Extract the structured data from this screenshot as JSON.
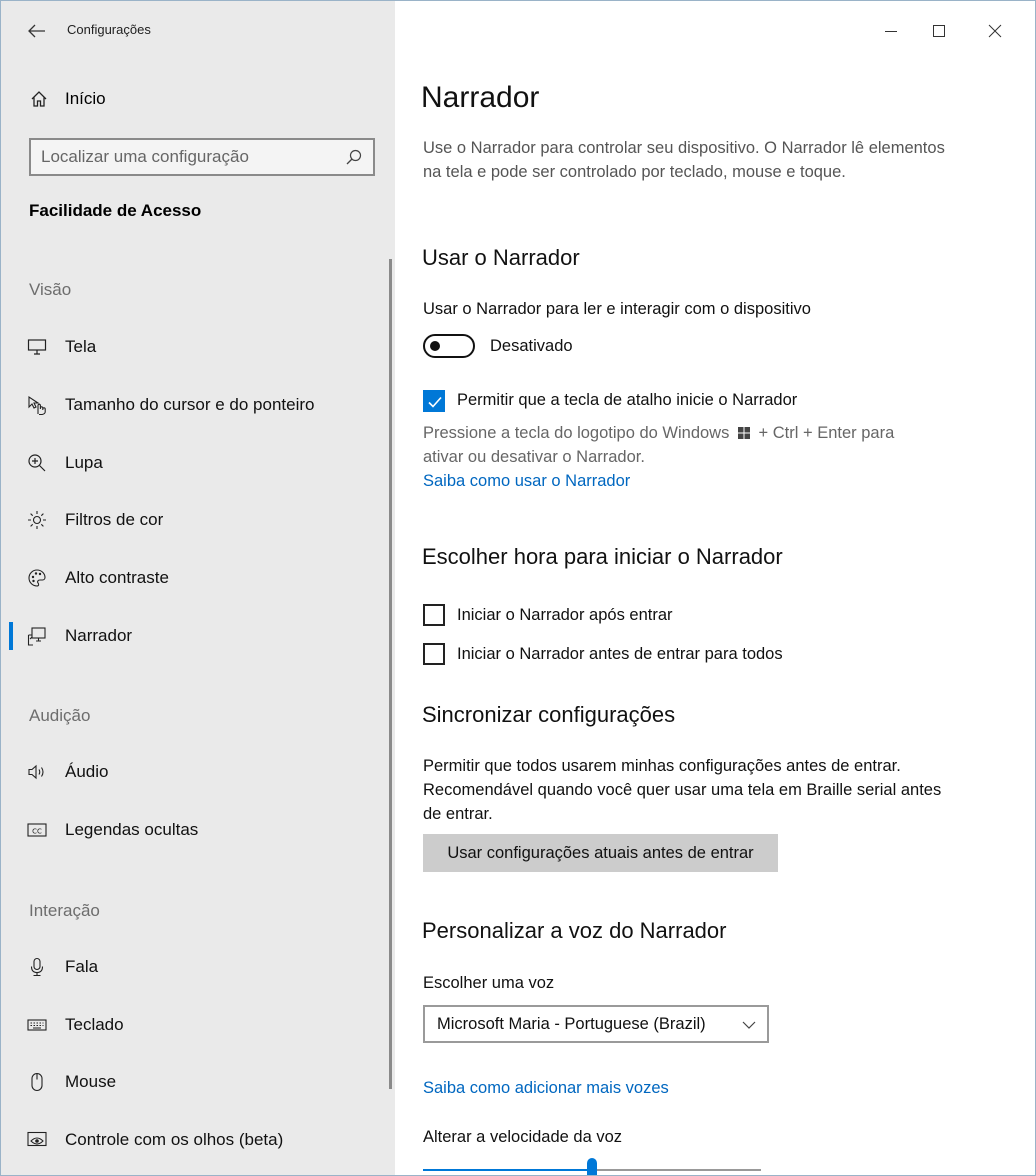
{
  "window": {
    "title": "Configurações"
  },
  "sidebar": {
    "home_label": "Início",
    "search_placeholder": "Localizar uma configuração",
    "section_heading": "Facilidade de Acesso",
    "groups": {
      "vision": "Visão",
      "hearing": "Audição",
      "interaction": "Interação"
    },
    "items": {
      "tela": "Tela",
      "cursor": "Tamanho do cursor e do ponteiro",
      "lupa": "Lupa",
      "filtros": "Filtros de cor",
      "contraste": "Alto contraste",
      "narrador": "Narrador",
      "audio": "Áudio",
      "legendas": "Legendas ocultas",
      "fala": "Fala",
      "teclado": "Teclado",
      "mouse": "Mouse",
      "olhos": "Controle com os olhos (beta)"
    },
    "selected_item": "Narrador"
  },
  "main": {
    "title": "Narrador",
    "description": "Use o Narrador para controlar seu dispositivo. O Narrador lê elementos na tela e pode ser controlado por teclado, mouse e toque.",
    "use": {
      "heading": "Usar o Narrador",
      "toggle_caption": "Usar o Narrador para ler e interagir com o dispositivo",
      "toggle_state": "Desativado",
      "toggle_on": false,
      "shortcut_checkbox_label": "Permitir que a tecla de atalho inicie o Narrador",
      "shortcut_checked": true,
      "shortcut_hint_before": "Pressione a tecla do logotipo do Windows",
      "shortcut_hint_after": "+ Ctrl + Enter para",
      "shortcut_hint_line2": "ativar ou desativar o Narrador.",
      "learn_link": "Saiba como usar o Narrador"
    },
    "start": {
      "heading": "Escolher hora para iniciar o Narrador",
      "after_signin": "Iniciar o Narrador após entrar",
      "after_signin_checked": false,
      "before_signin": "Iniciar o Narrador antes de entrar para todos",
      "before_signin_checked": false
    },
    "sync": {
      "heading": "Sincronizar configurações",
      "description": "Permitir que todos usarem minhas configurações antes de entrar. Recomendável quando você quer usar uma tela em Braille serial antes de entrar.",
      "button": "Usar configurações atuais antes de entrar"
    },
    "voice": {
      "heading": "Personalizar a voz do Narrador",
      "choose_label": "Escolher uma voz",
      "selected_voice": "Microsoft Maria - Portuguese (Brazil)",
      "add_voices_link": "Saiba como adicionar mais vozes",
      "speed_label": "Alterar a velocidade da voz",
      "speed_fraction": 0.5
    }
  },
  "colors": {
    "accent": "#0078d7",
    "link": "#0067c0",
    "sidebar_bg": "#eaeaea"
  }
}
